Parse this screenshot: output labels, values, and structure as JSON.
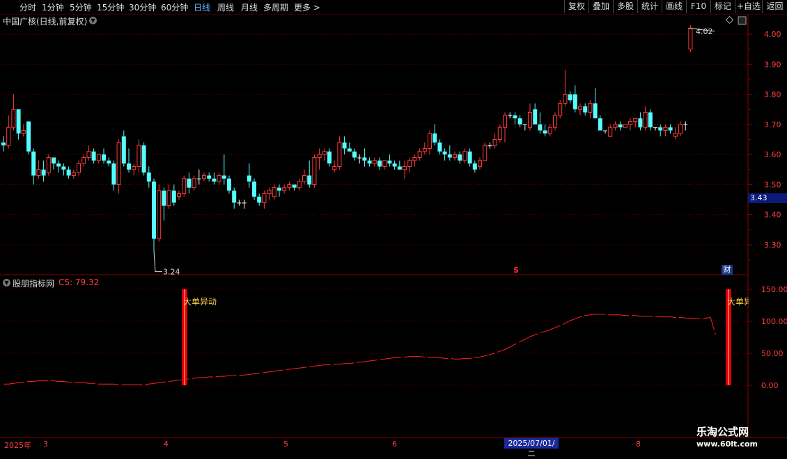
{
  "toolbar": {
    "timeframes": [
      "分时",
      "1分钟",
      "5分钟",
      "15分钟",
      "30分钟",
      "60分钟",
      "日线",
      "周线",
      "月线",
      "多周期",
      "更多 >"
    ],
    "active_timeframe": "日线",
    "buttons": [
      "复权",
      "叠加",
      "多股",
      "统计",
      "画线",
      "F10",
      "+自选",
      "返回"
    ],
    "corner_button": "标记"
  },
  "main_chart": {
    "title": "中国广核(日线,前复权)",
    "max_label": "4.02",
    "min_label": "3.24",
    "cursor_price": "3.43",
    "cai_badge": "财",
    "s_marker": "S"
  },
  "indicator": {
    "name": "股朋指标网",
    "value_label": "CS: 79.32",
    "signal_label": "大单异动"
  },
  "x_axis": {
    "labels": [
      "2025年",
      "3",
      "4",
      "5",
      "6",
      "8"
    ],
    "cursor_date": "2025/07/01/二"
  },
  "watermark": {
    "title": "乐淘公式网",
    "url": "www.60lt.com"
  },
  "colors": {
    "up": "#ff3b3b",
    "down": "#54ffff",
    "grid": "#7a0000",
    "line": "#ff2020",
    "flat": "#ffffff"
  },
  "chart_data": [
    {
      "type": "candlestick",
      "title": "中国广核(日线,前复权)",
      "ylim": [
        3.2,
        4.05
      ],
      "yticks": [
        3.3,
        3.4,
        3.5,
        3.6,
        3.7,
        3.8,
        3.9,
        4.0
      ],
      "ytick_labels": [
        "3.30",
        "3.40",
        "3.50",
        "3.60",
        "3.70",
        "3.80",
        "3.90",
        "4.00"
      ],
      "candles": [
        [
          3.64,
          3.66,
          3.61,
          3.63
        ],
        [
          3.63,
          3.73,
          3.62,
          3.69
        ],
        [
          3.69,
          3.8,
          3.68,
          3.75
        ],
        [
          3.75,
          3.75,
          3.65,
          3.67
        ],
        [
          3.67,
          3.7,
          3.66,
          3.68
        ],
        [
          3.71,
          3.71,
          3.6,
          3.61
        ],
        [
          3.61,
          3.62,
          3.5,
          3.53
        ],
        [
          3.53,
          3.58,
          3.52,
          3.55
        ],
        [
          3.55,
          3.58,
          3.51,
          3.53
        ],
        [
          3.54,
          3.6,
          3.53,
          3.59
        ],
        [
          3.59,
          3.59,
          3.55,
          3.57
        ],
        [
          3.57,
          3.58,
          3.54,
          3.56
        ],
        [
          3.56,
          3.57,
          3.53,
          3.55
        ],
        [
          3.55,
          3.56,
          3.52,
          3.53
        ],
        [
          3.53,
          3.55,
          3.52,
          3.54
        ],
        [
          3.54,
          3.58,
          3.53,
          3.57
        ],
        [
          3.57,
          3.6,
          3.56,
          3.59
        ],
        [
          3.59,
          3.63,
          3.58,
          3.61
        ],
        [
          3.61,
          3.62,
          3.57,
          3.58
        ],
        [
          3.58,
          3.6,
          3.57,
          3.6
        ],
        [
          3.6,
          3.62,
          3.57,
          3.58
        ],
        [
          3.58,
          3.59,
          3.56,
          3.57
        ],
        [
          3.57,
          3.58,
          3.48,
          3.5
        ],
        [
          3.5,
          3.65,
          3.47,
          3.64
        ],
        [
          3.66,
          3.68,
          3.56,
          3.57
        ],
        [
          3.57,
          3.62,
          3.54,
          3.55
        ],
        [
          3.55,
          3.57,
          3.53,
          3.56
        ],
        [
          3.56,
          3.65,
          3.54,
          3.63
        ],
        [
          3.63,
          3.64,
          3.53,
          3.54
        ],
        [
          3.54,
          3.56,
          3.49,
          3.51
        ],
        [
          3.51,
          3.52,
          3.28,
          3.32
        ],
        [
          3.32,
          3.5,
          3.31,
          3.48
        ],
        [
          3.48,
          3.49,
          3.38,
          3.43
        ],
        [
          3.43,
          3.5,
          3.42,
          3.48
        ],
        [
          3.48,
          3.5,
          3.43,
          3.44
        ],
        [
          3.46,
          3.48,
          3.45,
          3.47
        ],
        [
          3.47,
          3.53,
          3.46,
          3.52
        ],
        [
          3.52,
          3.54,
          3.47,
          3.49
        ],
        [
          3.49,
          3.53,
          3.48,
          3.52
        ],
        [
          3.52,
          3.55,
          3.5,
          3.52
        ],
        [
          3.52,
          3.54,
          3.51,
          3.53
        ],
        [
          3.53,
          3.54,
          3.51,
          3.52
        ],
        [
          3.52,
          3.54,
          3.5,
          3.51
        ],
        [
          3.51,
          3.54,
          3.5,
          3.53
        ],
        [
          3.53,
          3.6,
          3.5,
          3.52
        ],
        [
          3.52,
          3.53,
          3.47,
          3.48
        ],
        [
          3.48,
          3.49,
          3.42,
          3.44
        ],
        [
          3.44,
          3.45,
          3.43,
          3.44
        ],
        [
          3.44,
          3.45,
          3.42,
          3.44
        ],
        [
          3.53,
          3.57,
          3.49,
          3.51
        ],
        [
          3.51,
          3.52,
          3.45,
          3.46
        ],
        [
          3.46,
          3.47,
          3.43,
          3.44
        ],
        [
          3.44,
          3.48,
          3.42,
          3.47
        ],
        [
          3.47,
          3.49,
          3.45,
          3.48
        ],
        [
          3.46,
          3.5,
          3.45,
          3.49
        ],
        [
          3.49,
          3.5,
          3.46,
          3.48
        ],
        [
          3.48,
          3.5,
          3.47,
          3.49
        ],
        [
          3.49,
          3.51,
          3.48,
          3.5
        ],
        [
          3.5,
          3.5,
          3.48,
          3.49
        ],
        [
          3.49,
          3.52,
          3.48,
          3.51
        ],
        [
          3.51,
          3.55,
          3.5,
          3.53
        ],
        [
          3.53,
          3.58,
          3.49,
          3.5
        ],
        [
          3.5,
          3.6,
          3.49,
          3.59
        ],
        [
          3.59,
          3.62,
          3.55,
          3.6
        ],
        [
          3.6,
          3.62,
          3.58,
          3.61
        ],
        [
          3.61,
          3.62,
          3.56,
          3.57
        ],
        [
          3.55,
          3.58,
          3.54,
          3.56
        ],
        [
          3.56,
          3.66,
          3.55,
          3.64
        ],
        [
          3.64,
          3.66,
          3.6,
          3.62
        ],
        [
          3.62,
          3.64,
          3.61,
          3.61
        ],
        [
          3.61,
          3.62,
          3.58,
          3.59
        ],
        [
          3.59,
          3.6,
          3.57,
          3.59
        ],
        [
          3.59,
          3.62,
          3.56,
          3.58
        ],
        [
          3.58,
          3.59,
          3.56,
          3.57
        ],
        [
          3.57,
          3.59,
          3.56,
          3.58
        ],
        [
          3.58,
          3.59,
          3.55,
          3.56
        ],
        [
          3.56,
          3.58,
          3.55,
          3.58
        ],
        [
          3.58,
          3.6,
          3.56,
          3.57
        ],
        [
          3.57,
          3.58,
          3.55,
          3.56
        ],
        [
          3.56,
          3.58,
          3.55,
          3.55
        ],
        [
          3.55,
          3.58,
          3.52,
          3.56
        ],
        [
          3.56,
          3.59,
          3.54,
          3.58
        ],
        [
          3.58,
          3.6,
          3.56,
          3.59
        ],
        [
          3.59,
          3.62,
          3.58,
          3.61
        ],
        [
          3.61,
          3.64,
          3.6,
          3.62
        ],
        [
          3.62,
          3.68,
          3.6,
          3.67
        ],
        [
          3.67,
          3.7,
          3.63,
          3.64
        ],
        [
          3.64,
          3.65,
          3.6,
          3.61
        ],
        [
          3.61,
          3.62,
          3.58,
          3.6
        ],
        [
          3.6,
          3.63,
          3.58,
          3.59
        ],
        [
          3.59,
          3.61,
          3.58,
          3.6
        ],
        [
          3.6,
          3.61,
          3.57,
          3.58
        ],
        [
          3.58,
          3.62,
          3.57,
          3.61
        ],
        [
          3.61,
          3.62,
          3.56,
          3.57
        ],
        [
          3.57,
          3.58,
          3.54,
          3.55
        ],
        [
          3.56,
          3.59,
          3.55,
          3.58
        ],
        [
          3.58,
          3.64,
          3.58,
          3.63
        ],
        [
          3.63,
          3.64,
          3.62,
          3.63
        ],
        [
          3.63,
          3.67,
          3.62,
          3.65
        ],
        [
          3.65,
          3.7,
          3.64,
          3.69
        ],
        [
          3.69,
          3.74,
          3.64,
          3.73
        ],
        [
          3.73,
          3.74,
          3.72,
          3.73
        ],
        [
          3.73,
          3.74,
          3.7,
          3.72
        ],
        [
          3.72,
          3.73,
          3.69,
          3.7
        ],
        [
          3.7,
          3.7,
          3.68,
          3.7
        ],
        [
          3.69,
          3.77,
          3.68,
          3.74
        ],
        [
          3.75,
          3.77,
          3.7,
          3.7
        ],
        [
          3.7,
          3.74,
          3.67,
          3.68
        ],
        [
          3.68,
          3.7,
          3.66,
          3.67
        ],
        [
          3.67,
          3.7,
          3.66,
          3.69
        ],
        [
          3.69,
          3.74,
          3.68,
          3.73
        ],
        [
          3.73,
          3.78,
          3.72,
          3.77
        ],
        [
          3.77,
          3.88,
          3.76,
          3.8
        ],
        [
          3.8,
          3.81,
          3.77,
          3.78
        ],
        [
          3.8,
          3.83,
          3.74,
          3.75
        ],
        [
          3.75,
          3.77,
          3.73,
          3.76
        ],
        [
          3.76,
          3.77,
          3.73,
          3.74
        ],
        [
          3.74,
          3.78,
          3.72,
          3.77
        ],
        [
          3.77,
          3.82,
          3.72,
          3.72
        ],
        [
          3.72,
          3.73,
          3.68,
          3.68
        ],
        [
          3.68,
          3.68,
          3.67,
          3.68
        ],
        [
          3.66,
          3.7,
          3.66,
          3.69
        ],
        [
          3.69,
          3.71,
          3.68,
          3.7
        ],
        [
          3.7,
          3.71,
          3.68,
          3.69
        ],
        [
          3.69,
          3.7,
          3.69,
          3.7
        ],
        [
          3.7,
          3.72,
          3.68,
          3.71
        ],
        [
          3.71,
          3.72,
          3.69,
          3.72
        ],
        [
          3.72,
          3.74,
          3.68,
          3.69
        ],
        [
          3.69,
          3.76,
          3.68,
          3.74
        ],
        [
          3.74,
          3.75,
          3.68,
          3.69
        ],
        [
          3.69,
          3.69,
          3.68,
          3.69
        ],
        [
          3.69,
          3.7,
          3.66,
          3.68
        ],
        [
          3.68,
          3.7,
          3.66,
          3.69
        ],
        [
          3.69,
          3.7,
          3.67,
          3.68
        ],
        [
          3.66,
          3.69,
          3.65,
          3.67
        ],
        [
          3.67,
          3.71,
          3.66,
          3.7
        ],
        [
          3.7,
          3.71,
          3.68,
          3.7
        ],
        [
          3.95,
          4.03,
          3.94,
          4.02
        ]
      ],
      "annotations": [
        {
          "label": "4.02",
          "value": 4.02
        },
        {
          "label": "3.24",
          "value": 3.24
        }
      ]
    },
    {
      "type": "line",
      "title": "股朋指标网",
      "series": [
        {
          "name": "CS",
          "value_shown": 79.32,
          "values": [
            2,
            2,
            3,
            4,
            5,
            6,
            6,
            7,
            7,
            7,
            7,
            6,
            6,
            5,
            5,
            4,
            4,
            3,
            3,
            2,
            2,
            2,
            2,
            1,
            1,
            1,
            1,
            1,
            1,
            2,
            3,
            4,
            5,
            6,
            7,
            8,
            9,
            10,
            11,
            12,
            12,
            13,
            13,
            14,
            14,
            15,
            15,
            15,
            16,
            17,
            18,
            19,
            20,
            21,
            22,
            23,
            24,
            25,
            26,
            27,
            28,
            29,
            30,
            31,
            32,
            32,
            33,
            33,
            34,
            34,
            35,
            36,
            37,
            38,
            39,
            40,
            41,
            42,
            43,
            43,
            44,
            45,
            45,
            45,
            44,
            44,
            43,
            43,
            42,
            42,
            41,
            41,
            42,
            42,
            43,
            44,
            46,
            48,
            50,
            53,
            56,
            60,
            64,
            68,
            72,
            76,
            79,
            82,
            84,
            87,
            90,
            93,
            97,
            101,
            104,
            107,
            109,
            110,
            111,
            111,
            111,
            110,
            110,
            110,
            109,
            109,
            109,
            108,
            108,
            108,
            108,
            107,
            107,
            107,
            106,
            106,
            105,
            105,
            104,
            104,
            105,
            106,
            79.32
          ]
        }
      ],
      "ylim": [
        -75,
        160
      ],
      "yticks": [
        0,
        50,
        100,
        150
      ],
      "ytick_labels": [
        "0.00",
        "50.00",
        "100.00",
        "150.00"
      ],
      "signal_bars": [
        {
          "label": "大单异动",
          "from": 0,
          "to": 150
        },
        {
          "label": "大单异动",
          "from": 0,
          "to": 150
        }
      ]
    }
  ]
}
